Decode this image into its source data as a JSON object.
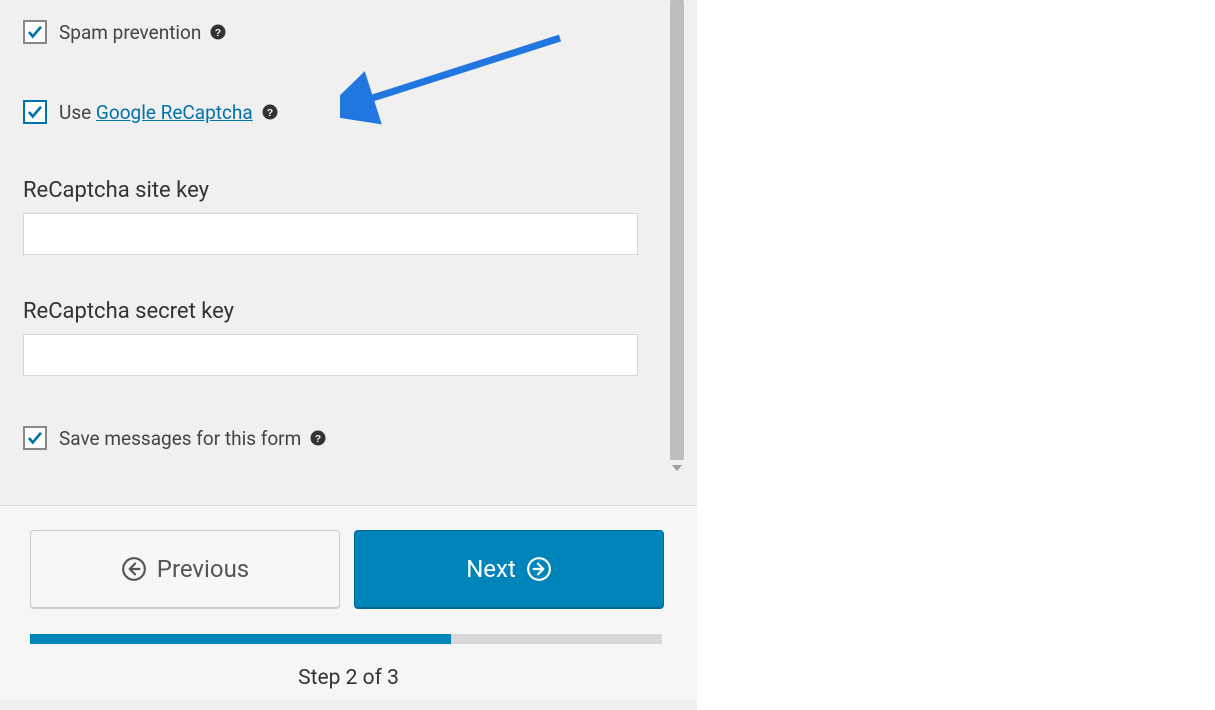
{
  "options": {
    "spam_prevention": {
      "label": "Spam prevention",
      "checked": true
    },
    "use_recaptcha": {
      "prefix": "Use ",
      "link_text": "Google ReCaptcha",
      "checked": true
    },
    "save_messages": {
      "label": "Save messages for this form",
      "checked": true
    }
  },
  "fields": {
    "site_key": {
      "label": "ReCaptcha site key",
      "value": ""
    },
    "secret_key": {
      "label": "ReCaptcha secret key",
      "value": ""
    }
  },
  "nav": {
    "previous": "Previous",
    "next": "Next",
    "step_text": "Step 2 of 3"
  },
  "colors": {
    "accent": "#0085ba",
    "link": "#0073aa",
    "arrow": "#2176e0"
  }
}
